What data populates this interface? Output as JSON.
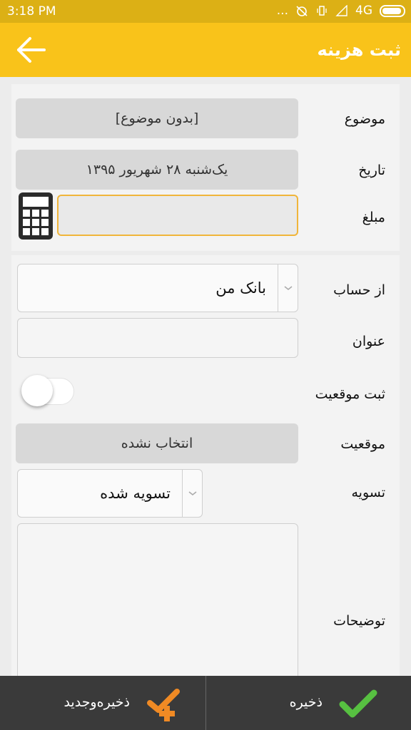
{
  "status_bar": {
    "time": "3:18 PM",
    "dots": "...",
    "network": "4G"
  },
  "app_bar": {
    "title": "ثبت هزینه",
    "back_icon": "arrow-left-icon"
  },
  "form": {
    "subject": {
      "label": "موضوع",
      "value": "[بدون موضوع]"
    },
    "date": {
      "label": "تاریخ",
      "value": "یک‌شنبه ۲۸ شهریور ۱۳۹۵"
    },
    "amount": {
      "label": "مبلغ",
      "value": "",
      "icon": "calculator-icon"
    },
    "from_account": {
      "label": "از حساب",
      "value": "بانک من"
    },
    "title_field": {
      "label": "عنوان",
      "value": ""
    },
    "record_location": {
      "label": "ثبت موقعیت",
      "enabled": false
    },
    "location": {
      "label": "موقعیت",
      "value": "انتخاب نشده"
    },
    "settlement": {
      "label": "تسویه",
      "value": "تسویه شده"
    },
    "notes": {
      "label": "توضیحات",
      "value": ""
    }
  },
  "bottom_bar": {
    "save_new_label": "ذخیره‌وجدید",
    "save_label": "ذخیره",
    "save_new_icon": "check-plus-icon",
    "save_icon": "check-icon"
  },
  "colors": {
    "accent": "#f9c31a",
    "status_bar": "#dcb015",
    "bottom_bar": "#3a3a3a",
    "save_icon": "#57c041",
    "save_new_icon": "#f08a24",
    "focus_border": "#f0b53a"
  }
}
